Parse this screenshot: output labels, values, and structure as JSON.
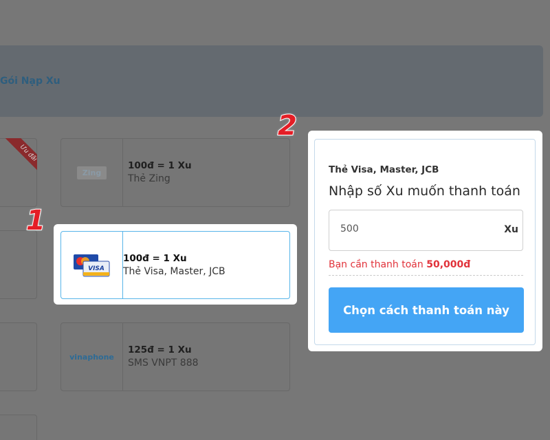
{
  "banner": {
    "title": "Gói Nạp Xu"
  },
  "badge": {
    "label": "Ưu đãi"
  },
  "annotations": {
    "step1": "1",
    "step2": "2"
  },
  "cards": [
    {
      "rate": "100đ = 1 Xu",
      "method": "Thẻ Zing",
      "logo": "Zing"
    },
    {
      "rate": "100đ = 1 Xu",
      "method": "Thẻ Visa, Master, JCB",
      "logo": "VISA"
    },
    {
      "rate": "125đ = 1 Xu",
      "method": "SMS VNPT 888",
      "logo": "vinaphone"
    }
  ],
  "panel": {
    "subtitle": "Thẻ Visa, Master, JCB",
    "title": "Nhập số Xu muốn thanh toán",
    "amount_value": "500",
    "amount_unit": "Xu",
    "need_label": "Bạn cần thanh toán",
    "need_amount": "50,000đ",
    "pay_button": "Chọn cách thanh toán này"
  },
  "colors": {
    "accent": "#44a5f5",
    "highlight_border": "#56b4e9",
    "warning": "#e1323a",
    "step_marker": "#e41e26"
  }
}
